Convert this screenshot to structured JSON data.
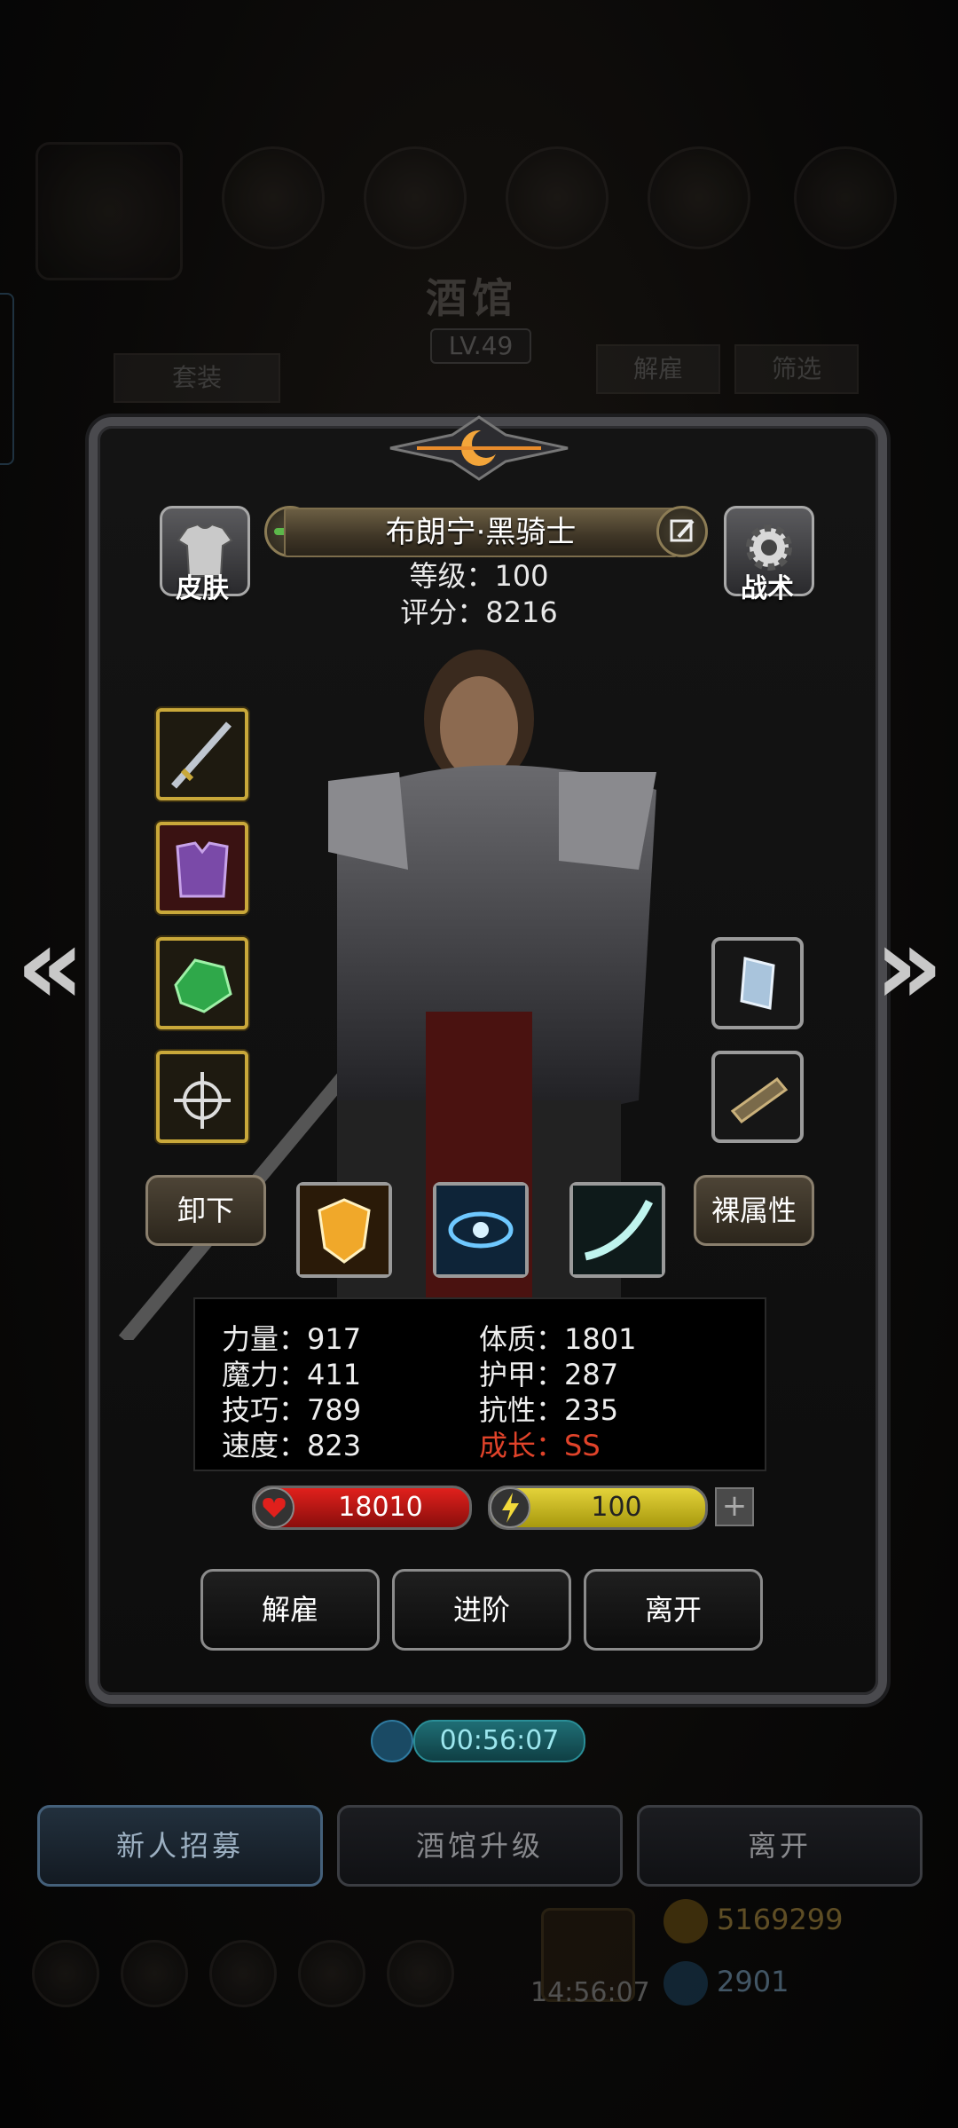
{
  "tavern": {
    "title": "酒馆",
    "level": "LV.49",
    "set_label": "套装",
    "dismiss_label": "解雇",
    "filter_label": "筛选",
    "timer": "00:56:07",
    "bottom_buttons": [
      "新人招募",
      "酒馆升级",
      "离开"
    ],
    "gold": "5169299",
    "gems": "2901",
    "gift_timer": "14:56:07"
  },
  "hero": {
    "name": "布朗宁·黑骑士",
    "level_label": "等级：100",
    "score_label": "评分：8216",
    "skin_label": "皮肤",
    "tactics_label": "战术",
    "unequip_label": "卸下",
    "base_attr_label": "裸属性"
  },
  "stats": {
    "left": [
      "力量：917",
      "魔力：411",
      "技巧：789",
      "速度：823"
    ],
    "right": [
      "体质：1801",
      "护甲：287",
      "抗性：235"
    ],
    "growth": "成长：SS"
  },
  "bars": {
    "hp": "18010",
    "energy": "100",
    "hp_color": "#d21e1a",
    "energy_color": "#d8c52c"
  },
  "actions": [
    "解雇",
    "进阶",
    "离开"
  ],
  "icons": {
    "equip": [
      "sword-icon",
      "armor-icon",
      "emerald-icon",
      "amulet-icon"
    ],
    "side": [
      "book-icon",
      "bracer-icon"
    ],
    "skills": [
      "shield-skill-icon",
      "eye-skill-icon",
      "slash-skill-icon"
    ]
  }
}
